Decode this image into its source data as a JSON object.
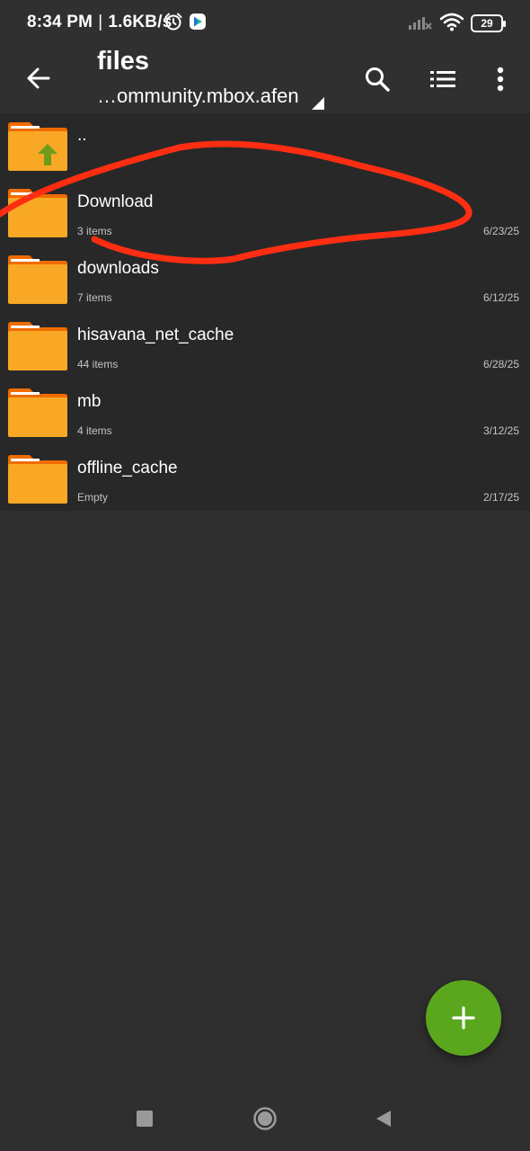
{
  "status_bar": {
    "time": "8:34 PM",
    "separator": "|",
    "net_speed": "1.6KB/s",
    "battery": "29",
    "icons": [
      "alarm-icon",
      "app-notification-icon",
      "signal-icon",
      "wifi-icon",
      "battery-icon"
    ]
  },
  "app_bar": {
    "title": "files",
    "path": "…ommunity.mbox.afen",
    "icons": [
      "back-arrow-icon",
      "search-icon",
      "list-view-icon",
      "more-vert-icon"
    ]
  },
  "files": [
    {
      "name": "..",
      "meta": "",
      "date": "",
      "type": "parent"
    },
    {
      "name": "Download",
      "meta": "3 items",
      "date": "6/23/25",
      "type": "folder"
    },
    {
      "name": "downloads",
      "meta": "7 items",
      "date": "6/12/25",
      "type": "folder"
    },
    {
      "name": "hisavana_net_cache",
      "meta": "44 items",
      "date": "6/28/25",
      "type": "folder"
    },
    {
      "name": "mb",
      "meta": "4 items",
      "date": "3/12/25",
      "type": "folder"
    },
    {
      "name": "offline_cache",
      "meta": "Empty",
      "date": "2/17/25",
      "type": "folder"
    }
  ],
  "fab": {
    "icon": "plus-icon"
  },
  "nav": {
    "icons": [
      "recents-square-icon",
      "home-circle-icon",
      "back-triangle-icon"
    ]
  },
  "colors": {
    "background": "#2f2f2f",
    "list_background": "#282828",
    "folder": "#f9a825",
    "folder_tab": "#ef6c00",
    "up_arrow": "#6b9c1a",
    "fab": "#5aa71e",
    "annotation": "#ff2e12"
  }
}
